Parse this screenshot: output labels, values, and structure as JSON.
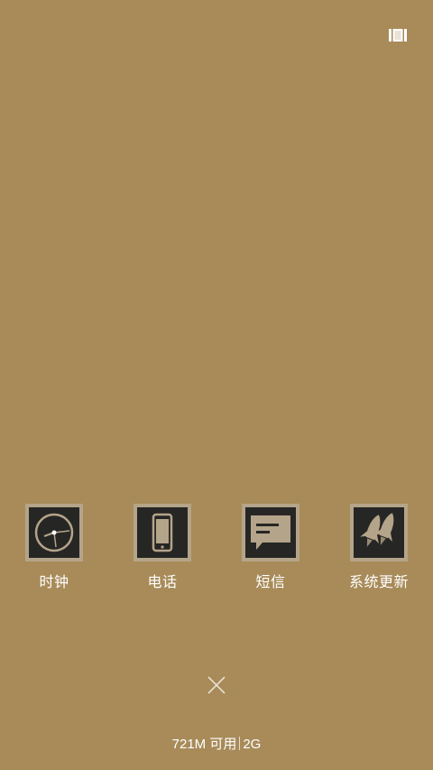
{
  "icons": {
    "layout_toggle": "columns-layout-icon",
    "close": "close-icon"
  },
  "apps": [
    {
      "label": "时钟",
      "icon": "clock-icon"
    },
    {
      "label": "电话",
      "icon": "phone-icon"
    },
    {
      "label": "短信",
      "icon": "message-icon"
    },
    {
      "label": "系统更新",
      "icon": "rocket-update-icon"
    }
  ],
  "memory": {
    "available": "721M 可用",
    "total": "2G"
  },
  "colors": {
    "background": "#a88b59",
    "thumbnail": "#262624",
    "thumbnail_border": "#b4a489",
    "text": "#ffffff"
  }
}
